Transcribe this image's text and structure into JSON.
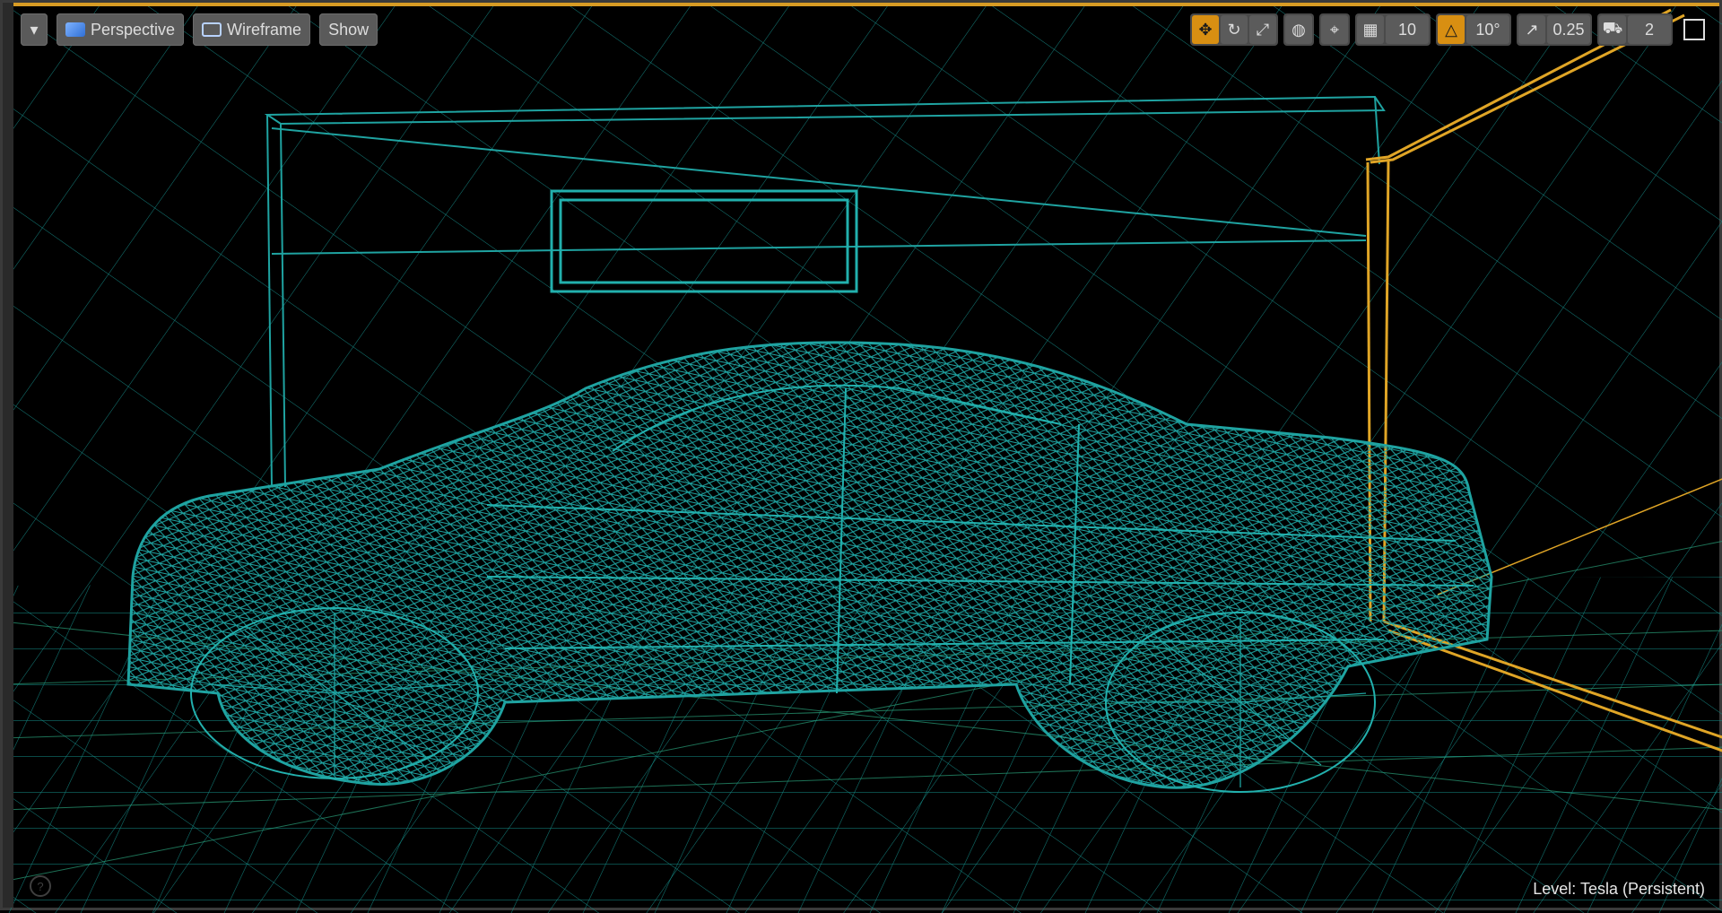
{
  "toolbar_left": {
    "menu_chevron": "▾",
    "perspective_label": "Perspective",
    "wireframe_label": "Wireframe",
    "show_label": "Show"
  },
  "toolbar_right": {
    "grid_snap_value": "10",
    "rotation_snap_value": "10°",
    "scale_snap_value": "0.25",
    "camera_speed_value": "2"
  },
  "status": {
    "level_prefix": "Level:",
    "level_name": "Tesla (Persistent)"
  },
  "help_symbol": "?",
  "colors": {
    "wire": "#1e9e9c",
    "selected": "#e0a526",
    "grid": "#1f8f7a",
    "background": "#000000"
  }
}
